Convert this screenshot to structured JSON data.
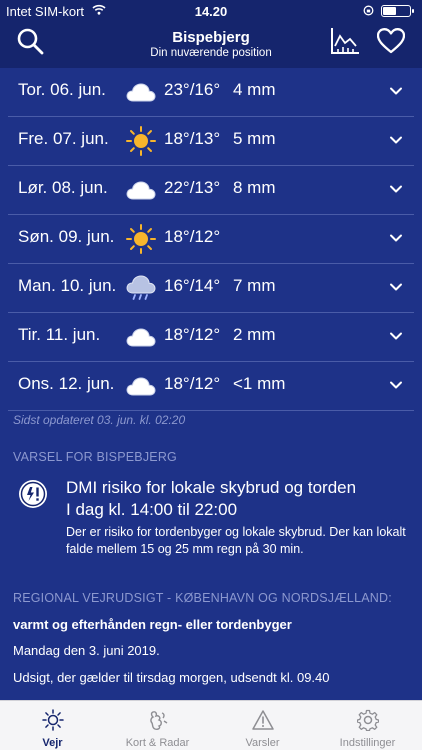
{
  "status_bar": {
    "carrier": "Intet SIM-kort",
    "time": "14.20"
  },
  "header": {
    "title": "Bispebjerg",
    "subtitle": "Din nuværende position"
  },
  "days": [
    {
      "label": "Tor. 06. jun.",
      "icon": "cloud-icon",
      "temp": "23°/16°",
      "rain": "4 mm"
    },
    {
      "label": "Fre. 07. jun.",
      "icon": "sun-icon",
      "temp": "18°/13°",
      "rain": "5 mm"
    },
    {
      "label": "Lør. 08. jun.",
      "icon": "cloud-icon",
      "temp": "22°/13°",
      "rain": "8 mm"
    },
    {
      "label": "Søn. 09. jun.",
      "icon": "sun-icon",
      "temp": "18°/12°",
      "rain": ""
    },
    {
      "label": "Man. 10. jun.",
      "icon": "rain-cloud-icon",
      "temp": "16°/14°",
      "rain": "7 mm"
    },
    {
      "label": "Tir. 11. jun.",
      "icon": "cloud-icon",
      "temp": "18°/12°",
      "rain": "2 mm"
    },
    {
      "label": "Ons. 12. jun.",
      "icon": "cloud-icon",
      "temp": "18°/12°",
      "rain": "<1 mm"
    }
  ],
  "updated": "Sidst opdateret 03. jun. kl. 02:20",
  "warning": {
    "heading": "VARSEL FOR BISPEBJERG",
    "title": "DMI risiko for lokale skybrud og torden",
    "time": "I dag kl. 14:00 til 22:00",
    "body": "Der er risiko for tordenbyger og lokale skybrud. Der kan lokalt falde mellem 15 og 25 mm regn på 30 min."
  },
  "regional": {
    "heading": "REGIONAL VEJRUDSIGT - KØBENHAVN OG NORDSJÆLLAND:",
    "title": "varmt og efterhånden regn- eller tordenbyger",
    "date": "Mandag den 3. juni 2019.",
    "issued": "Udsigt, der gælder til tirsdag morgen, udsendt kl. 09.40"
  },
  "tabs": [
    {
      "label": "Vejr",
      "icon": "sun-icon",
      "active": true
    },
    {
      "label": "Kort & Radar",
      "icon": "map-icon",
      "active": false
    },
    {
      "label": "Varsler",
      "icon": "warning-icon",
      "active": false
    },
    {
      "label": "Indstillinger",
      "icon": "gear-icon",
      "active": false
    }
  ],
  "colors": {
    "background": "#1e3288",
    "header": "#15256d",
    "sun": "#f7b52c",
    "tab_active": "#15256d"
  }
}
